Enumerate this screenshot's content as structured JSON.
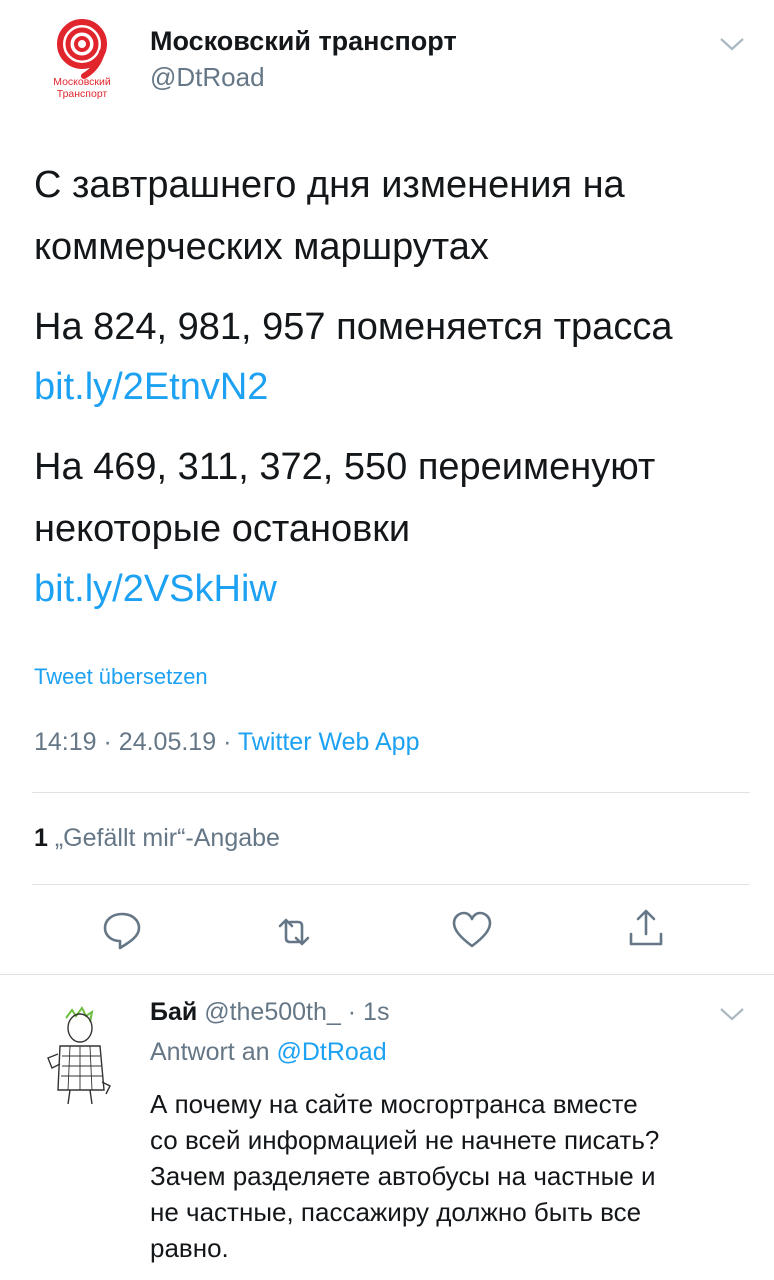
{
  "tweet": {
    "author_name": "Московский транспорт",
    "author_handle": "@DtRoad",
    "logo_text_line1": "Московский",
    "logo_text_line2": "Транспорт",
    "lines": [
      {
        "text": "С завтрашнего дня изменения на",
        "link": false
      },
      {
        "text": "коммерческих маршрутах",
        "link": false
      },
      {
        "text": "На 824, 981, 957 поменяется трасса",
        "link": false
      },
      {
        "text": "bit.ly/2EtnvN2",
        "link": true
      },
      {
        "text": "На 469, 311, 372, 550 переименуют",
        "link": false
      },
      {
        "text": "некоторые остановки",
        "link": false
      },
      {
        "text": "bit.ly/2VSkHiw",
        "link": true
      }
    ],
    "translate_label": "Tweet übersetzen",
    "time": "14:19",
    "date": "24.05.19",
    "source_app": "Twitter Web App",
    "likes_count": "1",
    "likes_label": "„Gefällt mir“-Angabe",
    "actions": [
      "reply-icon",
      "retweet-icon",
      "like-icon",
      "share-icon"
    ],
    "accent_color": "#1da1f2",
    "logo_color": "#e1252d"
  },
  "reply": {
    "name": "Бай",
    "handle": "@the500th_",
    "time": "1s",
    "reply_prefix": "Antwort an",
    "reply_to": "@DtRoad",
    "lines": [
      "А почему на сайте мосгортранса вместе",
      "со всей информацией не начнете писать?",
      "Зачем разделяете автобусы на частные и",
      "не частные, пассажиру должно быть все",
      "равно."
    ]
  }
}
